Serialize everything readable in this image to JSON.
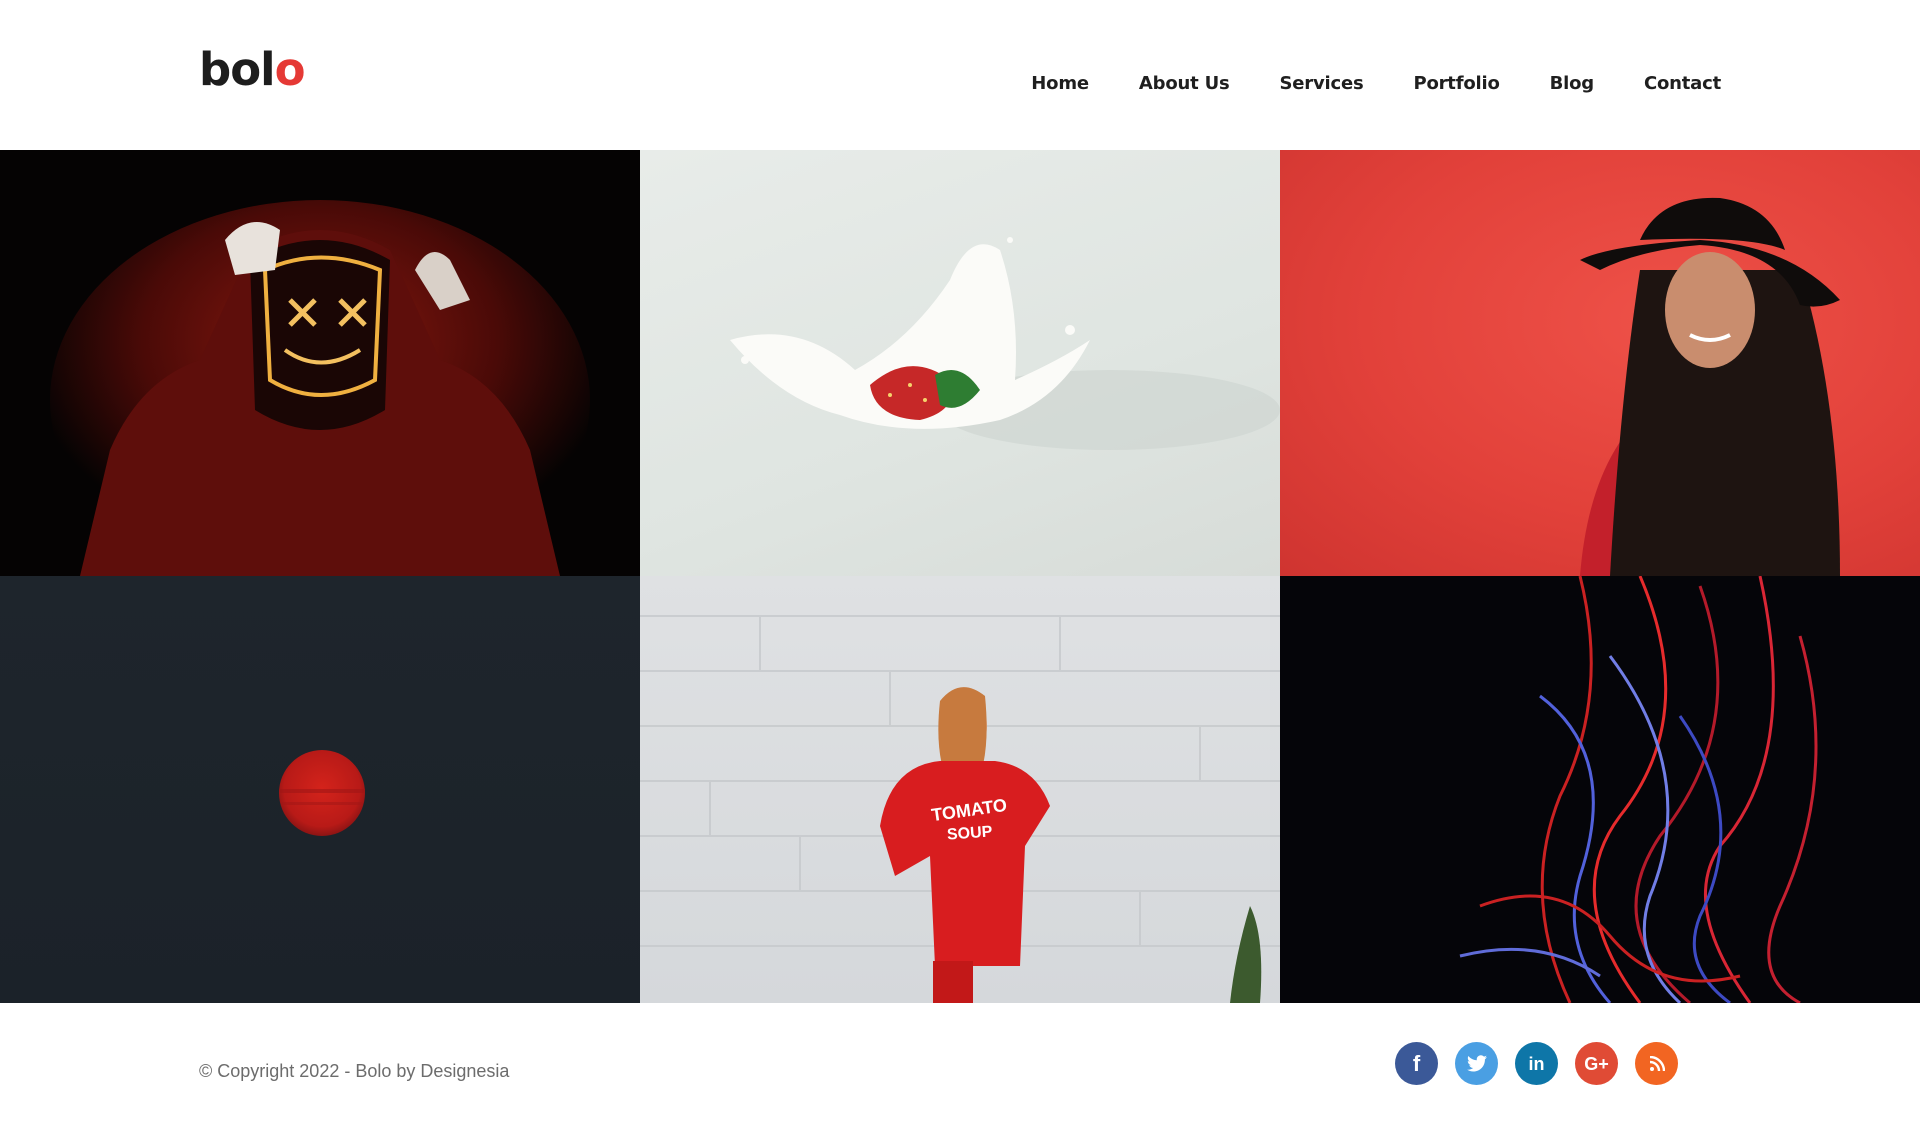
{
  "header": {
    "logo": {
      "text_main": "bol",
      "text_accent": "o"
    },
    "nav": [
      {
        "label": "Home"
      },
      {
        "label": "About Us"
      },
      {
        "label": "Services"
      },
      {
        "label": "Portfolio"
      },
      {
        "label": "Blog"
      },
      {
        "label": "Contact"
      }
    ]
  },
  "gallery": {
    "items": [
      {
        "subject": "hooded figure with glowing neon mask"
      },
      {
        "subject": "strawberry splashing in milk"
      },
      {
        "subject": "woman in black hat and red leather jacket"
      },
      {
        "subject": "red sun over dark sky"
      },
      {
        "subject": "woman in red Tomato Soup sweater against white brick wall",
        "printed_text": "TOMATO SOUP"
      },
      {
        "subject": "red and blue light trails"
      }
    ]
  },
  "footer": {
    "copyright": "© Copyright 2022 - Bolo by Designesia",
    "social": [
      {
        "name": "facebook-icon",
        "glyph": "f",
        "color": "#3b5998"
      },
      {
        "name": "twitter-icon",
        "glyph": "t",
        "color": "#4a9fe3"
      },
      {
        "name": "linkedin-icon",
        "glyph": "in",
        "color": "#0e76a8"
      },
      {
        "name": "google-plus-icon",
        "glyph": "G+",
        "color": "#e04b35"
      },
      {
        "name": "rss-icon",
        "glyph": "rss",
        "color": "#f26522"
      }
    ]
  },
  "colors": {
    "accent": "#e53935",
    "text": "#1f1f1f",
    "muted": "#6c6c6c"
  }
}
